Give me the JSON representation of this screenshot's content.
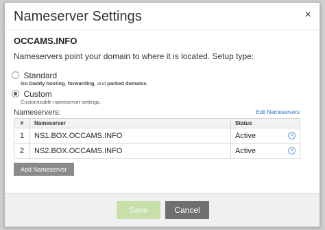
{
  "dialog": {
    "title": "Nameserver Settings",
    "close_glyph": "×",
    "domain": "OCCAMS.INFO",
    "intro": "Nameservers point your domain to where it is located. Setup type:"
  },
  "setup_types": [
    {
      "label": "Standard",
      "selected": false,
      "desc_parts": [
        "Go Daddy hosting",
        ", ",
        "forwarding",
        ", and ",
        "parked domains",
        "."
      ]
    },
    {
      "label": "Custom",
      "selected": true,
      "desc": "Customizable nameserver settings."
    }
  ],
  "nameservers": {
    "label": "Nameservers:",
    "edit_link": "Edit Nameservers",
    "columns": [
      "#",
      "Nameserver",
      "Status"
    ],
    "rows": [
      {
        "num": "1",
        "name": "NS1.BOX.OCCAMS.INFO",
        "status": "Active"
      },
      {
        "num": "2",
        "name": "NS2.BOX.OCCAMS.INFO",
        "status": "Active"
      }
    ],
    "remove_icon": "remove-circle-icon",
    "add_button": "Add Nameserver"
  },
  "footer": {
    "save_label": "Save",
    "cancel_label": "Cancel"
  },
  "colors": {
    "save_disabled": "#c7dfa9",
    "cancel": "#6f6f6f",
    "link": "#2a73c1",
    "add_button": "#8a8a8a"
  }
}
